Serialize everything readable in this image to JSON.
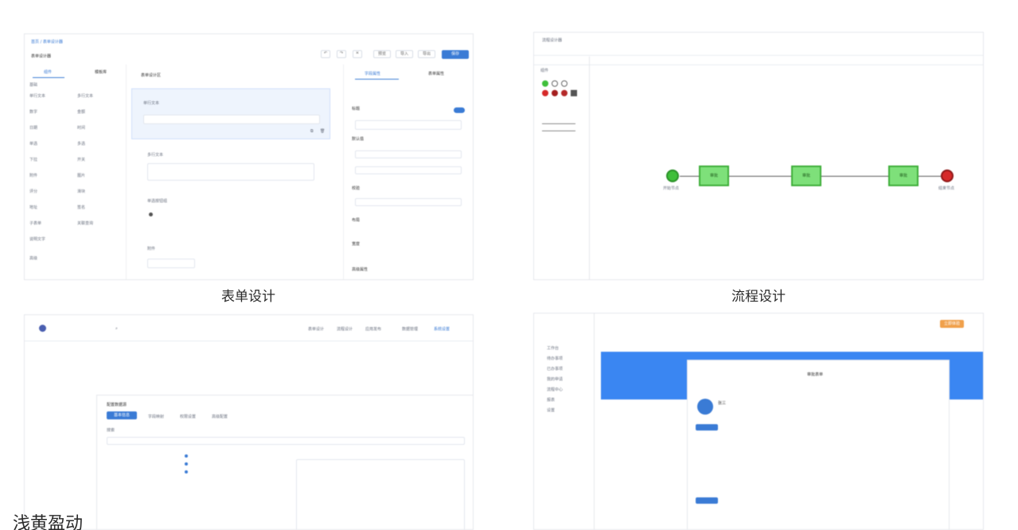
{
  "captions": {
    "form_design": "表单设计",
    "flow_design": "流程设计",
    "overlap_text": "浅黄盈动"
  },
  "form_designer": {
    "breadcrumb": "首页 / 表单设计器",
    "title": "表单设计器",
    "toolbar_buttons": [
      "预览",
      "导入",
      "导出",
      "保存"
    ],
    "left_tabs": [
      "组件",
      "模板库"
    ],
    "component_groups": [
      "基础",
      "高级"
    ],
    "components": [
      "单行文本",
      "多行文本",
      "数字",
      "金额",
      "日期",
      "时间",
      "单选",
      "多选",
      "下拉",
      "开关",
      "附件",
      "图片",
      "评分",
      "滑块",
      "地址",
      "签名",
      "子表单",
      "关联查询",
      "说明文字"
    ],
    "canvas_title": "表单设计区",
    "canvas_fields": [
      "单行文本",
      "多行文本",
      "单选按钮组",
      "附件"
    ],
    "right_tabs": [
      "字段属性",
      "表单属性"
    ],
    "props": [
      "标题",
      "默认值",
      "校验",
      "布局",
      "宽度",
      "高级属性"
    ],
    "colors": {
      "accent": "#3a7bd5"
    }
  },
  "flow_designer": {
    "title": "流程设计器",
    "palette_label": "组件",
    "nodes": [
      "开始",
      "审批",
      "审批",
      "审批",
      "结束"
    ],
    "start_label": "开始节点",
    "end_label": "结束节点",
    "colors": {
      "start": "#3fbf3a",
      "task": "#7ee07a",
      "end": "#d62a2a"
    }
  },
  "panel_c": {
    "nav_items": [
      "表单设计",
      "流程设计",
      "应用发布",
      "数据管理",
      "系统设置"
    ],
    "modal_title": "配置数据源",
    "modal_tabs": [
      "基本信息",
      "字段映射",
      "权限设置",
      "高级配置"
    ],
    "search_label": "搜索"
  },
  "panel_d": {
    "header_badge": "立即体验",
    "card_title": "审批表单",
    "sidebar_items": [
      "工作台",
      "待办事项",
      "已办事项",
      "我的申请",
      "流程中心",
      "报表",
      "设置"
    ],
    "user_name": "张三"
  }
}
